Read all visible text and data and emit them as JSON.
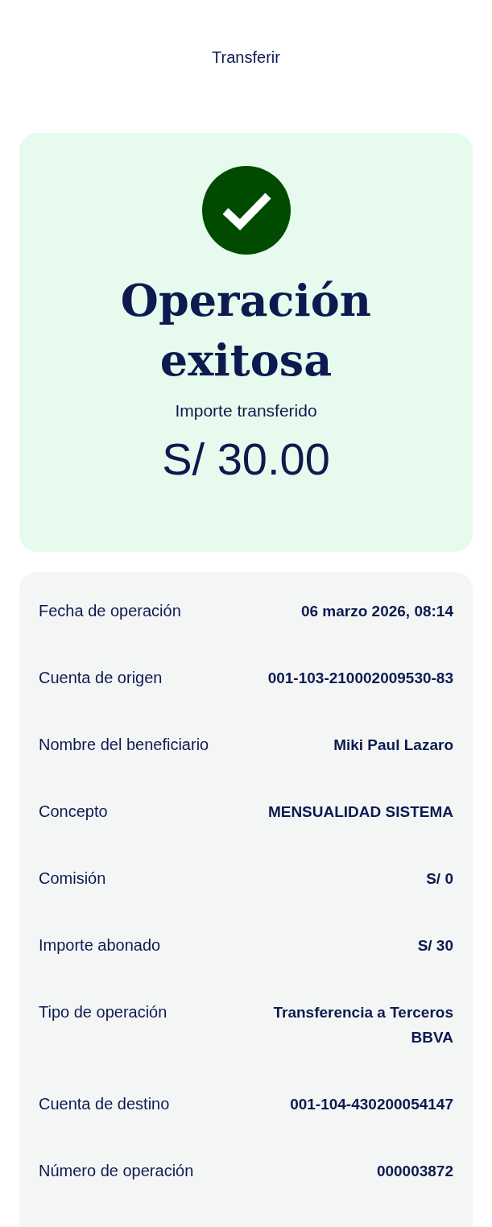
{
  "header": {
    "title": "Transferir"
  },
  "result": {
    "title": "Operación exitosa",
    "amount_label": "Importe transferido",
    "amount": "S/ 30.00"
  },
  "details": [
    {
      "label": "Fecha de operación",
      "value": "06 marzo 2026, 08:14"
    },
    {
      "label": "Cuenta de origen",
      "value": "001-103-210002009530-83"
    },
    {
      "label": "Nombre del beneficiario",
      "value": "Miki Paul Lazaro"
    },
    {
      "label": "Concepto",
      "value": "MENSUALIDAD SISTEMA"
    },
    {
      "label": "Comisión",
      "value": "S/ 0"
    },
    {
      "label": "Importe abonado",
      "value": "S/ 30"
    },
    {
      "label": "Tipo de operación",
      "value": "Transferencia a Terceros BBVA"
    },
    {
      "label": "Cuenta de destino",
      "value": "001-104-430200054147"
    },
    {
      "label": "Número de operación",
      "value": "000003872"
    }
  ]
}
